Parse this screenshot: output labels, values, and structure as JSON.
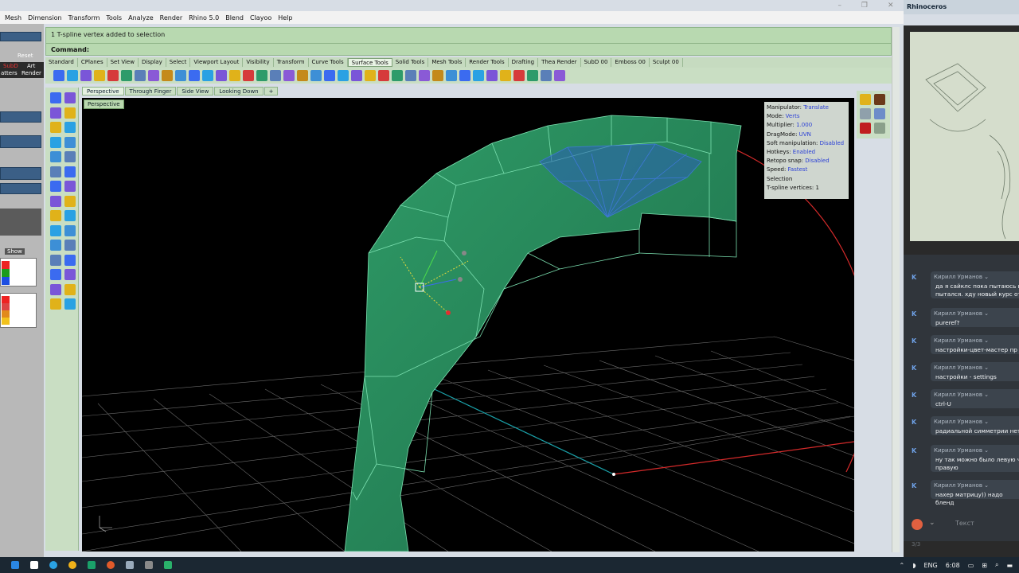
{
  "menu": [
    "Mesh",
    "Dimension",
    "Transform",
    "Tools",
    "Analyze",
    "Render",
    "Rhino 5.0",
    "Blend",
    "Clayoo",
    "Help"
  ],
  "window_controls": [
    "–",
    "❐",
    "✕"
  ],
  "left_panel": {
    "reset_label": "Reset",
    "subd_label": "SubD",
    "art_label": "Art",
    "atters_label": "atters",
    "render_label": "Render",
    "show_label": "Show"
  },
  "command": {
    "history": "1 T-spline vertex added to selection",
    "prompt": "Command:"
  },
  "toolbar_tabs": [
    "Standard",
    "CPlanes",
    "Set View",
    "Display",
    "Select",
    "Viewport Layout",
    "Visibility",
    "Transform",
    "Curve Tools",
    "Surface Tools",
    "Solid Tools",
    "Mesh Tools",
    "Render Tools",
    "Drafting",
    "Thea Render",
    "SubD 00",
    "Emboss 00",
    "Sculpt 00"
  ],
  "toolbar_active_tab": "Surface Tools",
  "viewport_tabs": [
    "Perspective",
    "Through Finger",
    "Side View",
    "Looking Down"
  ],
  "viewport_active_tab": "Perspective",
  "viewport_label": "Perspective",
  "manipulator": {
    "rows": [
      {
        "k": "Manipulator:",
        "v": "Translate"
      },
      {
        "k": "Mode:",
        "v": "Verts"
      },
      {
        "k": "Multiplier:",
        "v": "1.000"
      },
      {
        "k": "DragMode:",
        "v": "UVN"
      },
      {
        "k": "Soft manipulation:",
        "v": "Disabled"
      },
      {
        "k": "Hotkeys:",
        "v": "Enabled"
      },
      {
        "k": "Retopo snap:",
        "v": "Disabled"
      },
      {
        "k": "Speed:",
        "v": "Fastest"
      },
      {
        "k": "Selection",
        "v": ""
      },
      {
        "k": " T-spline vertices:",
        "v": "1"
      }
    ]
  },
  "right_app": {
    "title": "Rhinoceros",
    "chat": [
      {
        "name": "Кирилл Урманов ⌄",
        "text": "да я сайклс пока пытаюсь в пытался. хду новый курс от"
      },
      {
        "name": "Кирилл Урманов ⌄",
        "text": "pureref?"
      },
      {
        "name": "Кирилл Урманов ⌄",
        "text": "настройки-цвет-мастер пр"
      },
      {
        "name": "Кирилл Урманов ⌄",
        "text": "настройки - settings"
      },
      {
        "name": "Кирилл Урманов ⌄",
        "text": "ctrl-U"
      },
      {
        "name": "Кирилл Урманов ⌄",
        "text": "радиальной симметрии нет"
      },
      {
        "name": "Кирилл Урманов ⌄",
        "text": "ну так можно было левую ч правую"
      },
      {
        "name": "Кирилл Урманов ⌄",
        "text": "нахер матрицу)) надо бленд"
      }
    ],
    "input_placeholder": "Текст",
    "footer": "3/3"
  },
  "taskbar": {
    "lang": "ENG",
    "time": "6:08"
  },
  "colors": {
    "accent_green": "#b8d9b0",
    "model_green": "#2e8a5c",
    "gem_blue": "#3e78d6",
    "viewport_bg": "#000000"
  }
}
